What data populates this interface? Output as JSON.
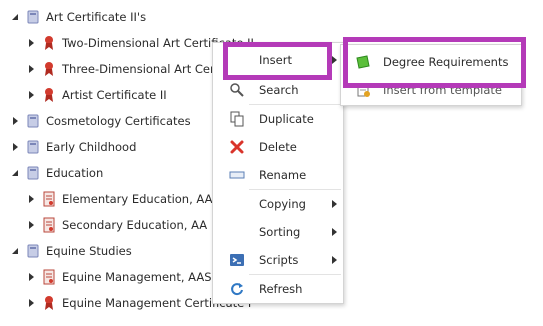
{
  "tree": {
    "items": [
      {
        "label": "Art Certificate II's",
        "type": "folder",
        "expanded": true
      },
      {
        "label": "Two-Dimensional Art Certificate II",
        "type": "certificate",
        "expanded": false
      },
      {
        "label": "Three-Dimensional Art Cer",
        "type": "certificate",
        "expanded": false
      },
      {
        "label": "Artist Certificate II",
        "type": "certificate",
        "expanded": false
      },
      {
        "label": "Cosmetology Certificates",
        "type": "folder",
        "expanded": false
      },
      {
        "label": "Early Childhood",
        "type": "folder",
        "expanded": false
      },
      {
        "label": "Education",
        "type": "folder",
        "expanded": true
      },
      {
        "label": "Elementary Education, AA",
        "type": "degree",
        "expanded": false
      },
      {
        "label": "Secondary Education, AA",
        "type": "degree",
        "expanded": false
      },
      {
        "label": "Equine Studies",
        "type": "folder",
        "expanded": true
      },
      {
        "label": "Equine Management, AAS",
        "type": "degree",
        "expanded": false
      },
      {
        "label": "Equine Management Certificate I",
        "type": "certificate",
        "expanded": false
      }
    ]
  },
  "context_menu": {
    "items": [
      {
        "label": "Insert",
        "icon": "none",
        "submenu": true
      },
      {
        "label": "Search",
        "icon": "magnifier-icon",
        "submenu": false
      },
      {
        "label": "Duplicate",
        "icon": "duplicate-icon",
        "submenu": false
      },
      {
        "label": "Delete",
        "icon": "delete-x-icon",
        "submenu": false
      },
      {
        "label": "Rename",
        "icon": "rename-icon",
        "submenu": false
      },
      {
        "label": "Copying",
        "icon": "none",
        "submenu": true
      },
      {
        "label": "Sorting",
        "icon": "none",
        "submenu": true
      },
      {
        "label": "Scripts",
        "icon": "scripts-icon",
        "submenu": true
      },
      {
        "label": "Refresh",
        "icon": "refresh-icon",
        "submenu": false
      }
    ]
  },
  "insert_submenu": {
    "items": [
      {
        "label": "Degree Requirements",
        "icon": "green-item-icon"
      },
      {
        "label": "Insert from template",
        "icon": "template-icon"
      }
    ]
  },
  "colors": {
    "highlight": "#b43ab8",
    "delete_red": "#d9342b",
    "folder_blue": "#8a96c8",
    "ribbon_red": "#c0392b"
  }
}
